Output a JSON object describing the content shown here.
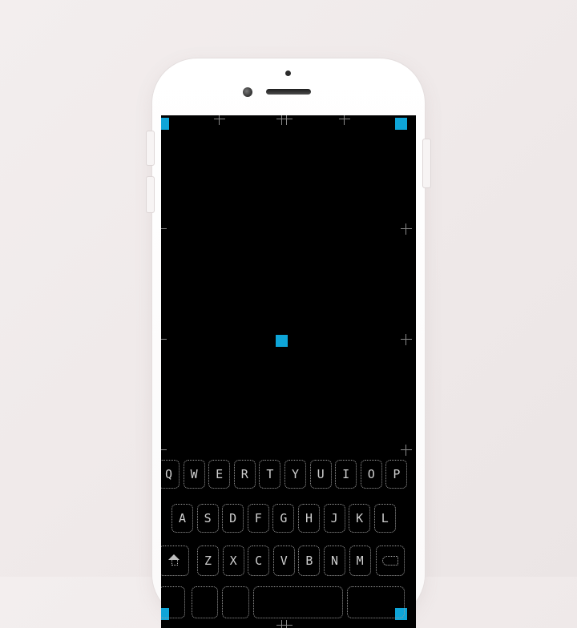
{
  "colors": {
    "accent": "#0ea5d8",
    "screen": "#000000",
    "key_outline": "#9a9a9a"
  },
  "markers": [
    {
      "name": "marker-top-left"
    },
    {
      "name": "marker-top-right"
    },
    {
      "name": "marker-center"
    },
    {
      "name": "marker-bottom-left"
    },
    {
      "name": "marker-bottom-right"
    }
  ],
  "keyboard": {
    "row1": [
      "Q",
      "W",
      "E",
      "R",
      "T",
      "Y",
      "U",
      "I",
      "O",
      "P"
    ],
    "row2": [
      "A",
      "S",
      "D",
      "F",
      "G",
      "H",
      "J",
      "K",
      "L"
    ],
    "row3_letters": [
      "Z",
      "X",
      "C",
      "V",
      "B",
      "N",
      "M"
    ],
    "shift_icon": "shift-arrow-icon",
    "backspace_icon": "backspace-icon",
    "bottom_row": [
      "",
      "",
      "",
      "",
      ""
    ]
  }
}
